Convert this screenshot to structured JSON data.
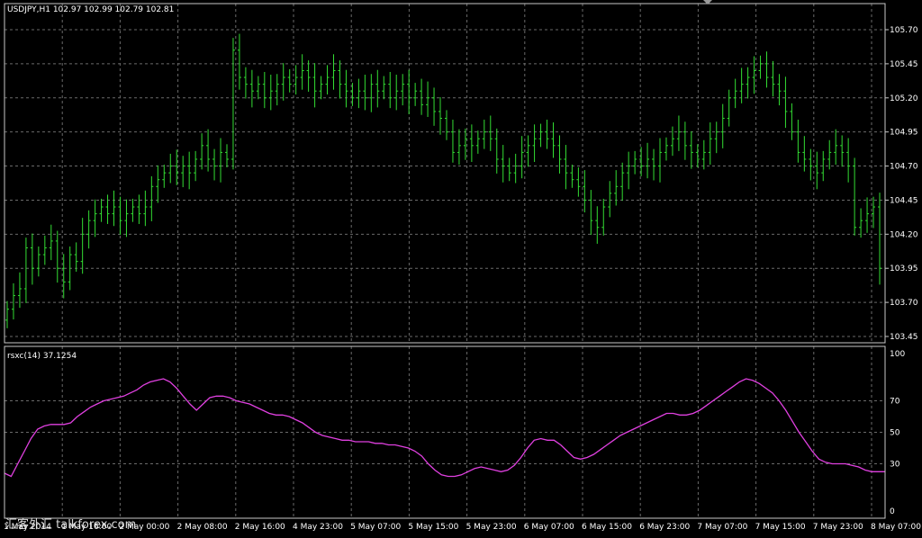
{
  "colors": {
    "background": "#000000",
    "grid": "#6a6a6a",
    "frame": "#c8c8c8",
    "text": "#ffffff",
    "bars": "#33dd33",
    "indicator": "#e040e0"
  },
  "watermark": "汇客外汇 talkforex.com",
  "price_panel": {
    "header": "USDJPY,H1  102.97 102.99 102.79 102.81",
    "y_ticks": [
      "105.70",
      "105.45",
      "105.20",
      "104.95",
      "104.70",
      "104.45",
      "104.20",
      "103.95",
      "103.70",
      "103.45"
    ]
  },
  "indicator_panel": {
    "header": "rsxc(14) 37.1254",
    "y_ticks": [
      "100",
      "70",
      "50",
      "30",
      "0"
    ]
  },
  "x_ticks": [
    "1 May 2014",
    "1 May 16:00",
    "2 May 00:00",
    "2 May 08:00",
    "2 May 16:00",
    "4 May 23:00",
    "5 May 07:00",
    "5 May 15:00",
    "5 May 23:00",
    "6 May 07:00",
    "6 May 15:00",
    "6 May 23:00",
    "7 May 07:00",
    "7 May 15:00",
    "7 May 23:00",
    "8 May 07:00"
  ],
  "chart_data": [
    {
      "type": "ohlc",
      "symbol": "USDJPY",
      "timeframe": "H1",
      "ylim": [
        103.45,
        105.7
      ],
      "series": [
        {
          "name": "USDJPY",
          "close": [
            103.65,
            103.75,
            103.8,
            104.1,
            103.95,
            104.05,
            104.1,
            104.15,
            103.95,
            103.85,
            104.05,
            104.0,
            104.2,
            104.3,
            104.35,
            104.4,
            104.35,
            104.4,
            104.3,
            104.35,
            104.4,
            104.35,
            104.4,
            104.55,
            104.6,
            104.65,
            104.7,
            104.65,
            104.7,
            104.65,
            104.75,
            104.85,
            104.75,
            104.7,
            104.8,
            104.75,
            105.55,
            105.35,
            105.3,
            105.25,
            105.3,
            105.2,
            105.25,
            105.3,
            105.35,
            105.3,
            105.35,
            105.4,
            105.35,
            105.25,
            105.3,
            105.35,
            105.4,
            105.3,
            105.25,
            105.2,
            105.25,
            105.2,
            105.3,
            105.25,
            105.3,
            105.2,
            105.25,
            105.3,
            105.2,
            105.25,
            105.15,
            105.2,
            105.1,
            105.05,
            104.95,
            104.8,
            104.85,
            104.9,
            104.85,
            104.9,
            104.95,
            104.9,
            104.75,
            104.7,
            104.65,
            104.7,
            104.8,
            104.85,
            104.9,
            104.95,
            104.9,
            104.85,
            104.75,
            104.65,
            104.6,
            104.55,
            104.45,
            104.3,
            104.25,
            104.4,
            104.5,
            104.55,
            104.65,
            104.7,
            104.75,
            104.7,
            104.75,
            104.7,
            104.8,
            104.85,
            104.9,
            104.95,
            104.85,
            104.8,
            104.75,
            104.8,
            104.9,
            104.95,
            105.05,
            105.2,
            105.25,
            105.3,
            105.35,
            105.4,
            105.45,
            105.35,
            105.3,
            105.25,
            105.1,
            104.95,
            104.8,
            104.75,
            104.7,
            104.65,
            104.75,
            104.8,
            104.85,
            104.8,
            104.7,
            104.25,
            104.3,
            104.35,
            104.4,
            103.95
          ]
        }
      ]
    },
    {
      "type": "line",
      "title": "rsxc(14) 37.1254",
      "ylim": [
        0,
        100
      ],
      "series": [
        {
          "name": "rsxc(14)",
          "values": [
            24,
            22,
            30,
            38,
            46,
            52,
            54,
            55,
            55,
            55,
            56,
            60,
            63,
            66,
            68,
            70,
            71,
            72,
            73,
            75,
            77,
            80,
            82,
            83,
            84,
            82,
            78,
            73,
            68,
            64,
            68,
            72,
            73,
            73,
            72,
            70,
            69,
            68,
            66,
            64,
            62,
            61,
            61,
            60,
            58,
            56,
            53,
            50,
            48,
            47,
            46,
            45,
            45,
            44,
            44,
            44,
            43,
            43,
            42,
            42,
            41,
            40,
            38,
            35,
            30,
            26,
            23,
            22,
            22,
            23,
            25,
            27,
            28,
            27,
            26,
            25,
            26,
            29,
            34,
            40,
            45,
            46,
            45,
            45,
            42,
            38,
            34,
            33,
            34,
            36,
            39,
            42,
            45,
            48,
            50,
            52,
            54,
            56,
            58,
            60,
            62,
            62,
            61,
            61,
            62,
            64,
            67,
            70,
            73,
            76,
            79,
            82,
            84,
            83,
            81,
            78,
            75,
            70,
            64,
            57,
            50,
            44,
            38,
            33,
            31,
            30,
            30,
            30,
            29,
            28,
            26,
            25,
            25,
            25
          ]
        }
      ]
    }
  ]
}
